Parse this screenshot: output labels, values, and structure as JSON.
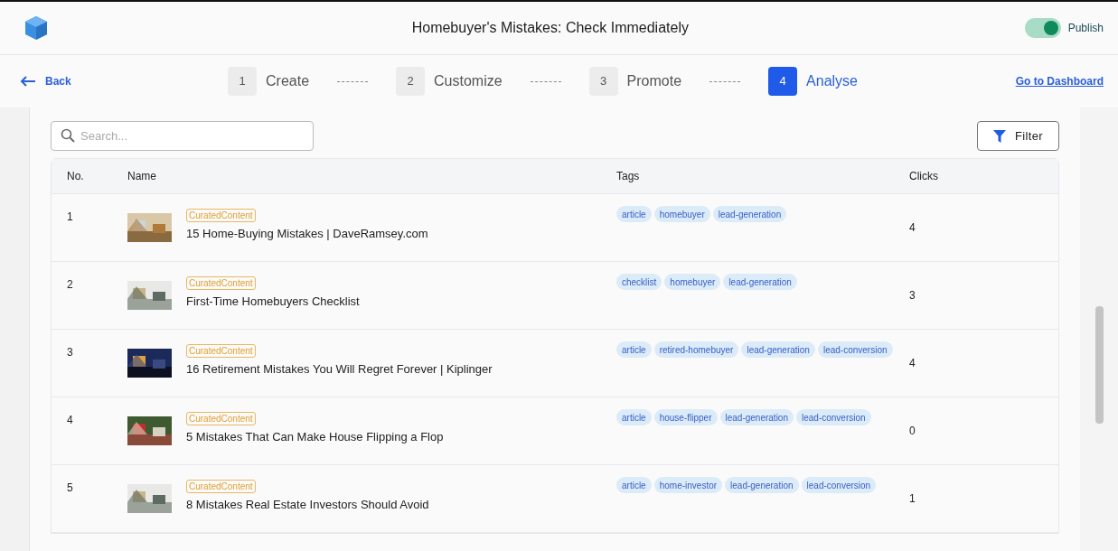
{
  "header": {
    "title": "Homebuyer's Mistakes: Check Immediately",
    "publish": {
      "label": "Publish",
      "on": true
    }
  },
  "nav": {
    "back": "Back",
    "dashboard": "Go to Dashboard",
    "steps": [
      {
        "number": "1",
        "label": "Create",
        "selected": false
      },
      {
        "number": "2",
        "label": "Customize",
        "selected": false
      },
      {
        "number": "3",
        "label": "Promote",
        "selected": false
      },
      {
        "number": "4",
        "label": "Analyse",
        "selected": true
      }
    ]
  },
  "search": {
    "placeholder": "Search..."
  },
  "filter_button": "Filter",
  "table": {
    "columns": [
      "No.",
      "Name",
      "Tags",
      "Clicks"
    ],
    "rows": [
      {
        "no": "1",
        "badge": "CuratedContent",
        "name": "15 Home-Buying Mistakes | DaveRamsey.com",
        "tags": [
          "article",
          "homebuyer",
          "lead-generation"
        ],
        "clicks": "4"
      },
      {
        "no": "2",
        "badge": "CuratedContent",
        "name": "First-Time Homebuyers Checklist",
        "tags": [
          "checklist",
          "homebuyer",
          "lead-generation"
        ],
        "clicks": "3"
      },
      {
        "no": "3",
        "badge": "CuratedContent",
        "name": "16 Retirement Mistakes You Will Regret Forever | Kiplinger",
        "tags": [
          "article",
          "retired-homebuyer",
          "lead-generation",
          "lead-conversion"
        ],
        "clicks": "4"
      },
      {
        "no": "4",
        "badge": "CuratedContent",
        "name": "5 Mistakes That Can Make House Flipping a Flop",
        "tags": [
          "article",
          "house-flipper",
          "lead-generation",
          "lead-conversion"
        ],
        "clicks": "0"
      },
      {
        "no": "5",
        "badge": "CuratedContent",
        "name": "8 Mistakes Real Estate Investors Should Avoid",
        "tags": [
          "article",
          "home-investor",
          "lead-generation",
          "lead-conversion"
        ],
        "clicks": "1"
      }
    ]
  }
}
